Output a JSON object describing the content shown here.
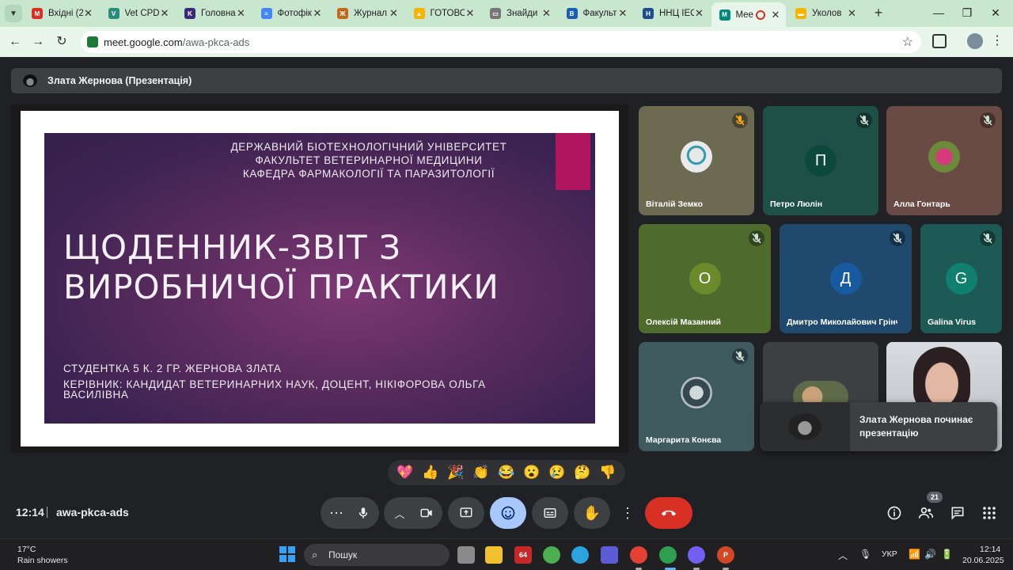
{
  "browser": {
    "tabs": [
      {
        "title": "Вхідні (2",
        "favicon": "gmail-icon",
        "color": "#d93025",
        "letter": "M"
      },
      {
        "title": "Vet CPD",
        "favicon": "vet-icon",
        "color": "#2a8c7b",
        "letter": "V"
      },
      {
        "title": "Головна",
        "favicon": "k-icon",
        "color": "#3b2a7a",
        "letter": "K"
      },
      {
        "title": "Фотофікс",
        "favicon": "docs-icon",
        "color": "#4285f4",
        "letter": "≡"
      },
      {
        "title": "Журнал",
        "favicon": "journal-icon",
        "color": "#c26a1b",
        "letter": "Ж"
      },
      {
        "title": "ГОТОВО",
        "favicon": "drive-icon",
        "color": "#f4b400",
        "letter": "▲"
      },
      {
        "title": "Знайди",
        "favicon": "find-icon",
        "color": "#777777",
        "letter": "▭"
      },
      {
        "title": "Факульт",
        "favicon": "btu-icon",
        "color": "#1a5fb4",
        "letter": "B"
      },
      {
        "title": "ННЦ ІЕС",
        "favicon": "nnc-icon",
        "color": "#1c4e8c",
        "letter": "Н"
      },
      {
        "title": "Mee",
        "favicon": "meet-icon",
        "color": "#00897b",
        "letter": "M",
        "active": true
      },
      {
        "title": "Уколов",
        "favicon": "slides-icon",
        "color": "#f4b400",
        "letter": "▬"
      }
    ],
    "url_host": "meet.google.com",
    "url_path": "/awa-pkca-ads"
  },
  "meet": {
    "presenter_label": "Злата Жернова (Презентація)",
    "slide": {
      "institution": [
        "ДЕРЖАВНИЙ БІОТЕХНОЛОГІЧНИЙ УНІВЕРСИТЕТ",
        "ФАКУЛЬТЕТ ВЕТЕРИНАРНОЇ МЕДИЦИНИ",
        "КАФЕДРА ФАРМАКОЛОГІЇ ТА ПАРАЗИТОЛОГІЇ"
      ],
      "title_line1": "ЩОДЕННИК-ЗВІТ З",
      "title_line2": "ВИРОБНИЧОЇ ПРАКТИКИ",
      "student": "СТУДЕНТКА 5 К. 2 ГР. ЖЕРНОВА ЗЛАТА",
      "supervisor_line1": "КЕРІВНИК: КАНДИДАТ ВЕТЕРИНАРНИХ НАУК, ДОЦЕНТ, НІКІФОРОВА ОЛЬГА",
      "supervisor_line2": "ВАСИЛІВНА"
    },
    "participants": [
      {
        "name": "Віталій Земко",
        "kind": "photo",
        "bg": "#6d6a52"
      },
      {
        "name": "Петро Люлін",
        "kind": "letter",
        "letter": "П",
        "bg": "#1e5047",
        "circle": "#0b4a3a"
      },
      {
        "name": "Алла Гонтарь",
        "kind": "photo",
        "bg": "#6a4a45"
      },
      {
        "name": "Олексій Мазанний",
        "kind": "letter",
        "letter": "О",
        "bg": "#4e6a2d",
        "circle": "#6c8a2b"
      },
      {
        "name": "Дмитро Миколайович Грінч...",
        "kind": "letter",
        "letter": "Д",
        "bg": "#1f4a6e",
        "circle": "#175aa0"
      },
      {
        "name": "Galina Virus",
        "kind": "letter",
        "letter": "G",
        "bg": "#1d5a55",
        "circle": "#108070"
      },
      {
        "name": "Маргарита Конєва",
        "kind": "photo",
        "bg": "#3e5a5e"
      },
      {
        "name": "",
        "kind": "photo",
        "bg": "#3c4043"
      },
      {
        "name": "",
        "kind": "video",
        "bg": "#c7c9cc"
      }
    ],
    "toast_text": "Злата Жернова починає презентацію",
    "reactions": [
      "💖",
      "👍",
      "🎉",
      "👏",
      "😂",
      "😮",
      "😢",
      "🤔",
      "👎"
    ],
    "clock": "12:14",
    "meeting_code": "awa-pkca-ads",
    "people_count": "21"
  },
  "taskbar": {
    "weather_temp": "17°C",
    "weather_desc": "Rain showers",
    "search_label": "Пошук",
    "language": "УКР",
    "time": "12:14",
    "date": "20.06.2025"
  }
}
